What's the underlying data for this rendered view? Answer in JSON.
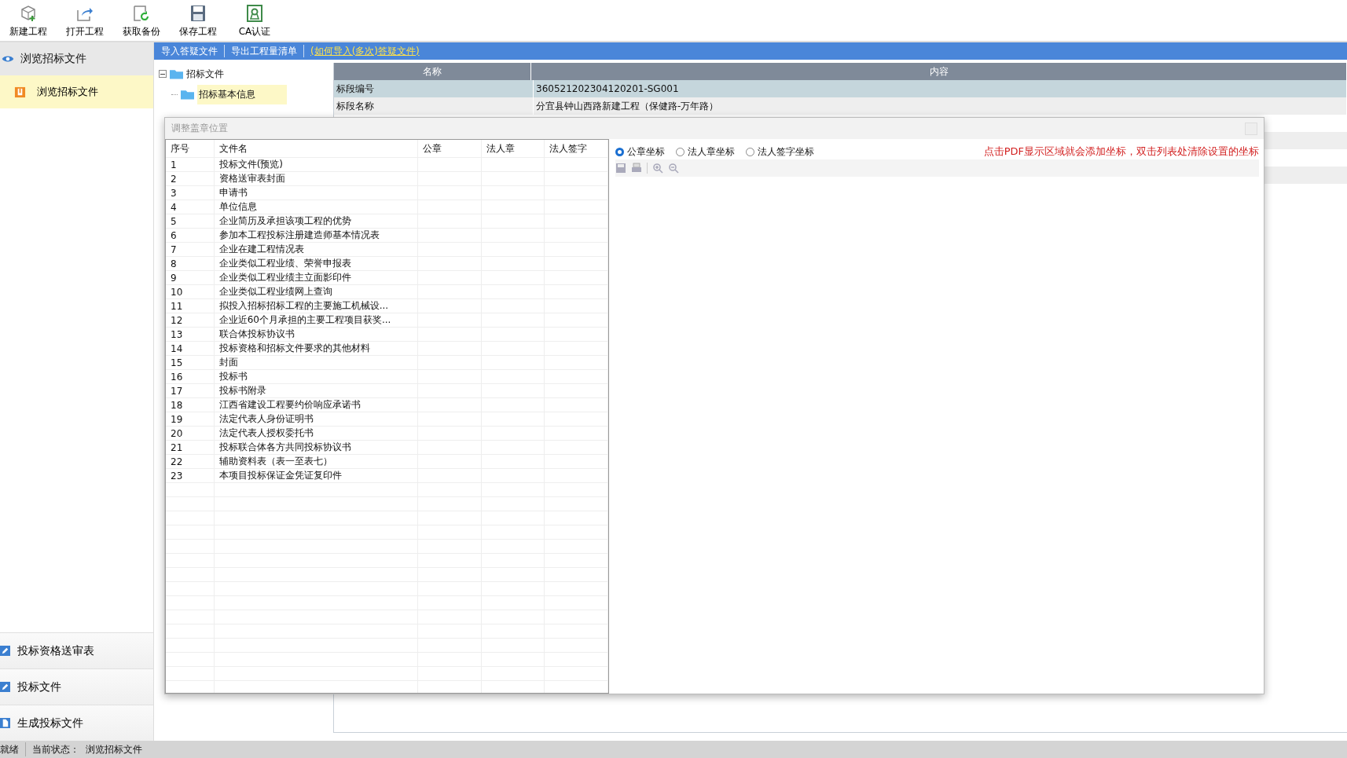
{
  "toolbar": [
    {
      "label": "新建工程"
    },
    {
      "label": "打开工程"
    },
    {
      "label": "获取备份"
    },
    {
      "label": "保存工程"
    },
    {
      "label": "CA认证"
    }
  ],
  "sidebar": {
    "header": "浏览招标文件",
    "items": [
      {
        "label": "浏览招标文件",
        "selected": true
      }
    ],
    "bottom_items": [
      {
        "label": "投标资格送审表"
      },
      {
        "label": "投标文件"
      },
      {
        "label": "生成投标文件"
      }
    ]
  },
  "action_bar": {
    "buttons": [
      "导入答疑文件",
      "导出工程量清单"
    ],
    "link": "(如何导入(多次)答疑文件)"
  },
  "tree": {
    "label": "招标文件",
    "expanded": true,
    "children": [
      {
        "label": "招标基本信息",
        "selected": true
      }
    ]
  },
  "grid": {
    "columns": [
      "名称",
      "内容"
    ],
    "rows": [
      {
        "name": "标段编号",
        "value": "360521202304120201-SG001",
        "selected": true
      },
      {
        "name": "标段名称",
        "value": "分宜县钟山西路新建工程（保健路-万年路）",
        "selected": false
      }
    ]
  },
  "dialog": {
    "title": "调整盖章位置",
    "columns": [
      "序号",
      "文件名",
      "公章",
      "法人章",
      "法人签字"
    ],
    "rows": [
      {
        "no": "1",
        "name": "投标文件(预览)"
      },
      {
        "no": "2",
        "name": "资格送审表封面"
      },
      {
        "no": "3",
        "name": "申请书"
      },
      {
        "no": "4",
        "name": "单位信息"
      },
      {
        "no": "5",
        "name": "企业简历及承担该项工程的优势"
      },
      {
        "no": "6",
        "name": "参加本工程投标注册建造师基本情况表"
      },
      {
        "no": "7",
        "name": "企业在建工程情况表"
      },
      {
        "no": "8",
        "name": "企业类似工程业绩、荣誉申报表"
      },
      {
        "no": "9",
        "name": "企业类似工程业绩主立面影印件"
      },
      {
        "no": "10",
        "name": "企业类似工程业绩网上查询"
      },
      {
        "no": "11",
        "name": "拟投入招标招标工程的主要施工机械设..."
      },
      {
        "no": "12",
        "name": "企业近60个月承担的主要工程项目获奖..."
      },
      {
        "no": "13",
        "name": "联合体投标协议书"
      },
      {
        "no": "14",
        "name": "投标资格和招标文件要求的其他材料"
      },
      {
        "no": "15",
        "name": "封面"
      },
      {
        "no": "16",
        "name": "投标书"
      },
      {
        "no": "17",
        "name": "投标书附录"
      },
      {
        "no": "18",
        "name": "江西省建设工程要约价响应承诺书"
      },
      {
        "no": "19",
        "name": "法定代表人身份证明书"
      },
      {
        "no": "20",
        "name": "法定代表人授权委托书"
      },
      {
        "no": "21",
        "name": "投标联合体各方共同投标协议书"
      },
      {
        "no": "22",
        "name": "辅助资料表（表一至表七）"
      },
      {
        "no": "23",
        "name": "本项目投标保证金凭证复印件"
      }
    ],
    "radios": [
      {
        "label": "公章坐标",
        "selected": true
      },
      {
        "label": "法人章坐标",
        "selected": false
      },
      {
        "label": "法人签字坐标",
        "selected": false
      }
    ],
    "hint": "点击PDF显示区域就会添加坐标，双击列表处清除设置的坐标"
  },
  "status_bar": {
    "state": "就绪",
    "label": "当前状态：",
    "value": "浏览招标文件"
  }
}
